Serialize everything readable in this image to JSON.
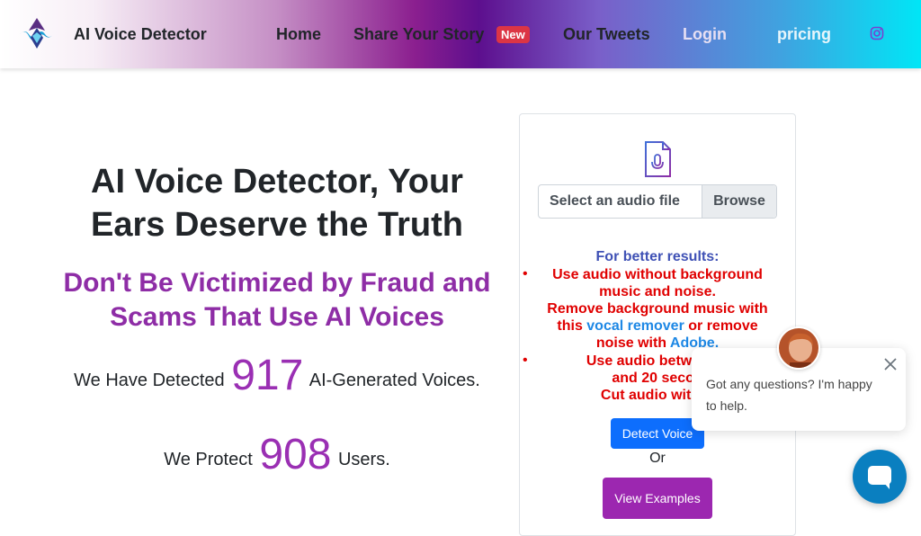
{
  "brand": {
    "name": "AI Voice Detector"
  },
  "nav": {
    "home": "Home",
    "story": "Share Your Story",
    "story_badge": "New",
    "tweets": "Our Tweets",
    "login": "Login",
    "pricing": "pricing"
  },
  "hero": {
    "title": "AI Voice Detector, Your Ears Deserve the Truth",
    "subtitle": "Don't Be Victimized by Fraud and Scams That Use AI Voices",
    "detected_prefix": "We Have Detected",
    "detected_count": "917",
    "detected_suffix": "AI-Generated Voices.",
    "protect_prefix": "We Protect",
    "protect_count": "908",
    "protect_suffix": "Users."
  },
  "upload": {
    "file_placeholder": "Select an audio file",
    "browse_label": "Browse",
    "tips_title": "For better results:",
    "tip1": "Use audio without background music and noise.",
    "tip2_a": "Remove background music with this ",
    "tip2_link1": "vocal remover",
    "tip2_b": " or remove noise with ",
    "tip2_link2": "Adobe",
    "tip2_c": ".",
    "tip3_a": "Use audio between 1",
    "tip3_b": "and 20 secon",
    "tip3_c": "Cut audio with ",
    "tip3_link": "C",
    "detect_label": "Detect Voice",
    "or_label": "Or",
    "examples_label": "View Examples"
  },
  "chat": {
    "message": "Got any questions? I'm happy to help."
  },
  "colors": {
    "accent_purple": "#9c27b0",
    "primary_blue": "#0d6efd",
    "tip_red": "#e00000",
    "badge_red": "#dc3545"
  },
  "icons": [
    "brand-logo-icon",
    "instagram-icon",
    "microphone-file-icon",
    "close-icon",
    "chat-bubble-icon"
  ]
}
